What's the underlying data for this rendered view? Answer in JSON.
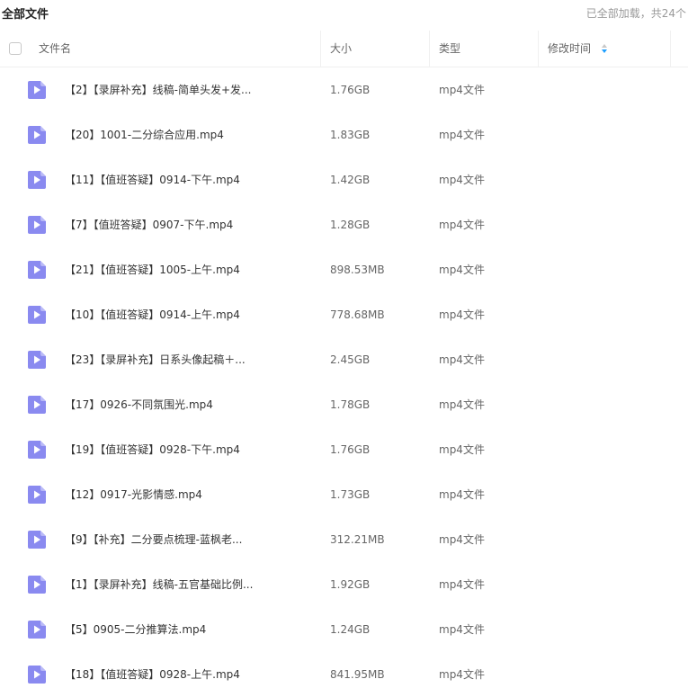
{
  "topbar": {
    "title": "全部文件",
    "status": "已全部加载，共24个"
  },
  "columns": {
    "name": "文件名",
    "size": "大小",
    "type": "类型",
    "modified": "修改时间"
  },
  "icons": {
    "file": "video-file-icon",
    "sort": "sort-arrows-icon"
  },
  "colors": {
    "icon": "#8a8af0",
    "sort_accent": "#1e9fff"
  },
  "files": [
    {
      "name": "【2】【录屏补充】线稿-简单头发+发...",
      "size": "1.76GB",
      "type": "mp4文件"
    },
    {
      "name": "【20】1001-二分综合应用.mp4",
      "size": "1.83GB",
      "type": "mp4文件"
    },
    {
      "name": "【11】【值班答疑】0914-下午.mp4",
      "size": "1.42GB",
      "type": "mp4文件"
    },
    {
      "name": "【7】【值班答疑】0907-下午.mp4",
      "size": "1.28GB",
      "type": "mp4文件"
    },
    {
      "name": "【21】【值班答疑】1005-上午.mp4",
      "size": "898.53MB",
      "type": "mp4文件"
    },
    {
      "name": "【10】【值班答疑】0914-上午.mp4",
      "size": "778.68MB",
      "type": "mp4文件"
    },
    {
      "name": "【23】【录屏补充】日系头像起稿＋...",
      "size": "2.45GB",
      "type": "mp4文件"
    },
    {
      "name": "【17】0926-不同氛围光.mp4",
      "size": "1.78GB",
      "type": "mp4文件"
    },
    {
      "name": "【19】【值班答疑】0928-下午.mp4",
      "size": "1.76GB",
      "type": "mp4文件"
    },
    {
      "name": "【12】0917-光影情感.mp4",
      "size": "1.73GB",
      "type": "mp4文件"
    },
    {
      "name": "【9】【补充】二分要点梳理-蓝枫老...",
      "size": "312.21MB",
      "type": "mp4文件"
    },
    {
      "name": "【1】【录屏补充】线稿-五官基础比例...",
      "size": "1.92GB",
      "type": "mp4文件"
    },
    {
      "name": "【5】0905-二分推算法.mp4",
      "size": "1.24GB",
      "type": "mp4文件"
    },
    {
      "name": "【18】【值班答疑】0928-上午.mp4",
      "size": "841.95MB",
      "type": "mp4文件"
    }
  ]
}
